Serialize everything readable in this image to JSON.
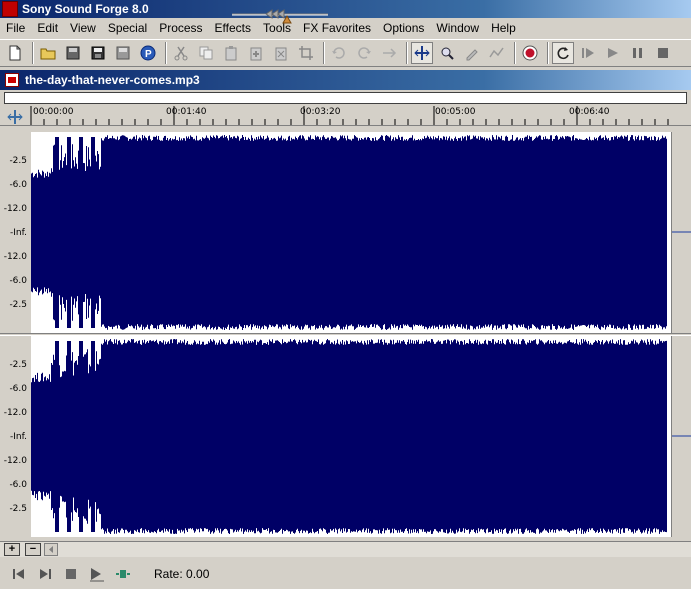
{
  "app": {
    "title": "Sony Sound Forge 8.0"
  },
  "menu": [
    "File",
    "Edit",
    "View",
    "Special",
    "Process",
    "Effects",
    "Tools",
    "FX Favorites",
    "Options",
    "Window",
    "Help"
  ],
  "document": {
    "filename": "the-day-that-never-comes.mp3",
    "ruler_ticks": [
      "00:00:00",
      "00:01:40",
      "00:03:20",
      "00:05:00",
      "00:06:40"
    ],
    "db_scale": [
      "-2.5",
      "-6.0",
      "-12.0",
      "-Inf.",
      "-12.0",
      "-6.0",
      "-2.5"
    ]
  },
  "transport": {
    "rate_label": "Rate: 0.00"
  },
  "colors": {
    "waveform": "#000066",
    "waveform_bg": "#ffffff",
    "titlebar": "#0a246a"
  }
}
